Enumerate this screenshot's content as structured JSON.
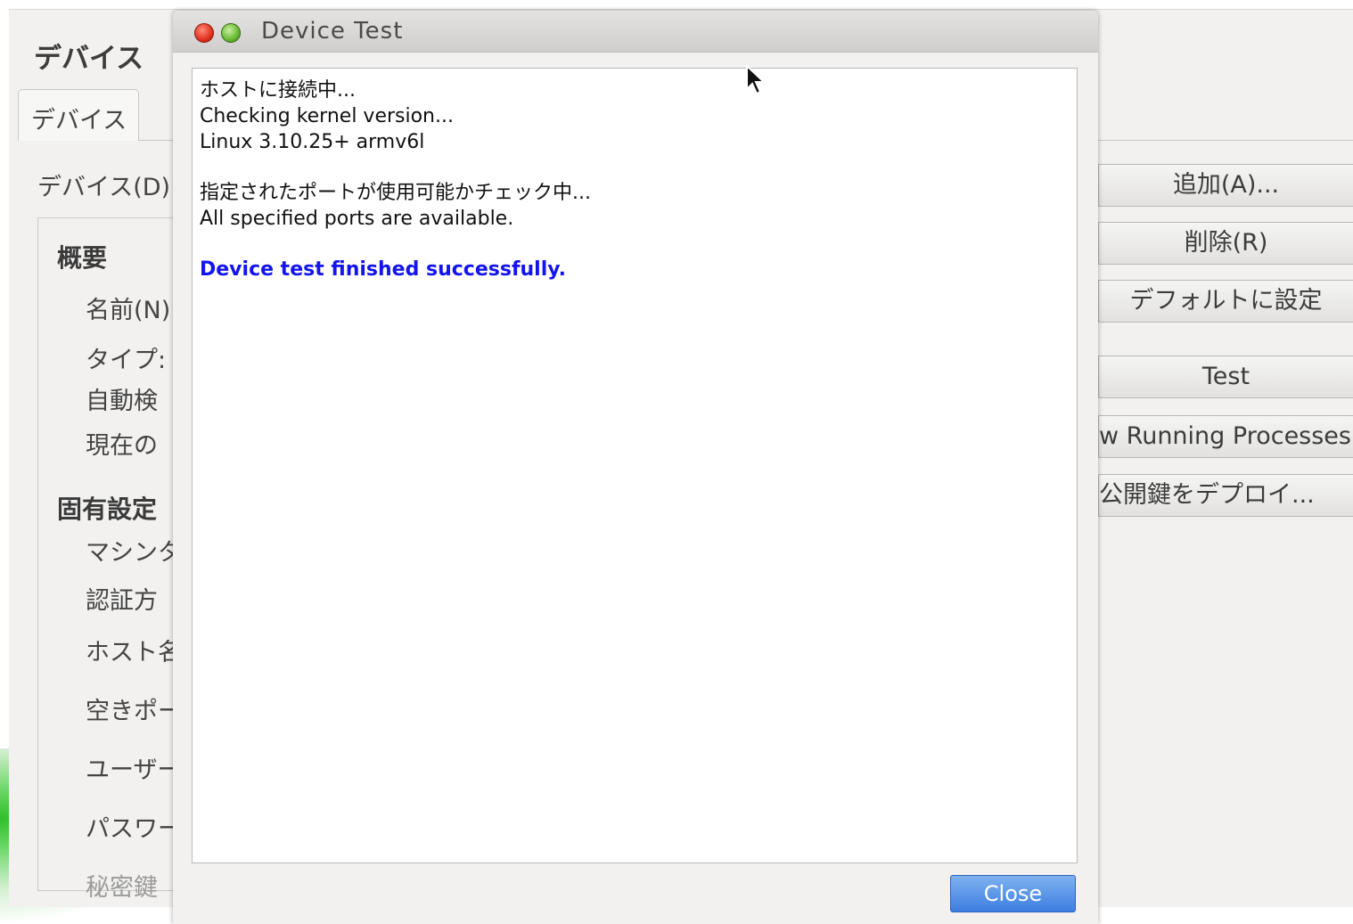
{
  "background": {
    "title": "デバイス",
    "tab": "デバイス",
    "device_label": "デバイス(D):",
    "sections": {
      "summary": "概要",
      "specific": "固有設定"
    },
    "fields": {
      "name": "名前(N)",
      "type": "タイプ:",
      "auto_detect": "自動検",
      "current": "現在の",
      "machine": "マシンタ",
      "auth": "認証方",
      "host": "ホスト名",
      "ports": "空きポー",
      "user": "ユーザー",
      "password": "パスワー",
      "private_key": "秘密鍵"
    },
    "buttons": {
      "add": "追加(A)...",
      "remove": "削除(R)",
      "set_default": "デフォルトに設定",
      "test": "Test",
      "show_processes": "w Running Processes",
      "deploy_key": "公開鍵をデプロイ..."
    }
  },
  "dialog": {
    "title": "Device Test",
    "output": {
      "line1": "ホストに接続中...",
      "line2": "Checking kernel version...",
      "line3": "Linux 3.10.25+ armv6l",
      "line4": "指定されたポートが使用可能かチェック中...",
      "line5": "All specified ports are available.",
      "success": "Device test finished successfully."
    },
    "close_label": "Close"
  },
  "colors": {
    "success_text": "#1414ee",
    "close_button": "#3c7ee0",
    "window_bg": "#f2f1f0"
  },
  "icons": {
    "close": "window-close-icon",
    "maximize": "window-maximize-icon",
    "cursor": "mouse-pointer-icon"
  }
}
